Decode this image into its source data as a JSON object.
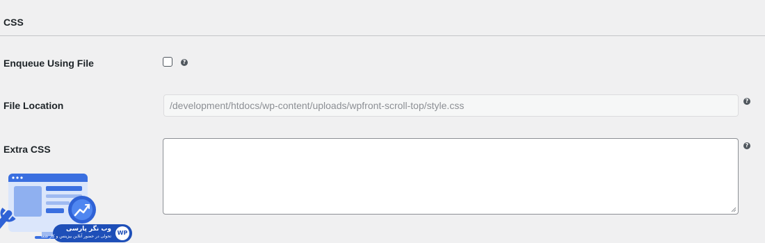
{
  "section": {
    "title": "CSS"
  },
  "fields": {
    "enqueue": {
      "label": "Enqueue Using File",
      "checked": false
    },
    "file_location": {
      "label": "File Location",
      "value": "/development/htdocs/wp-content/uploads/wpfront-scroll-top/style.css"
    },
    "extra_css": {
      "label": "Extra CSS",
      "value": ""
    }
  },
  "help_icon": {
    "glyph": "?",
    "icon": "question-circle-icon"
  },
  "watermark": {
    "title": "وب نگر پارسی",
    "subtitle": "تحولی در حضور آنلاین بیزینس و کار شما",
    "mark": "WP"
  }
}
